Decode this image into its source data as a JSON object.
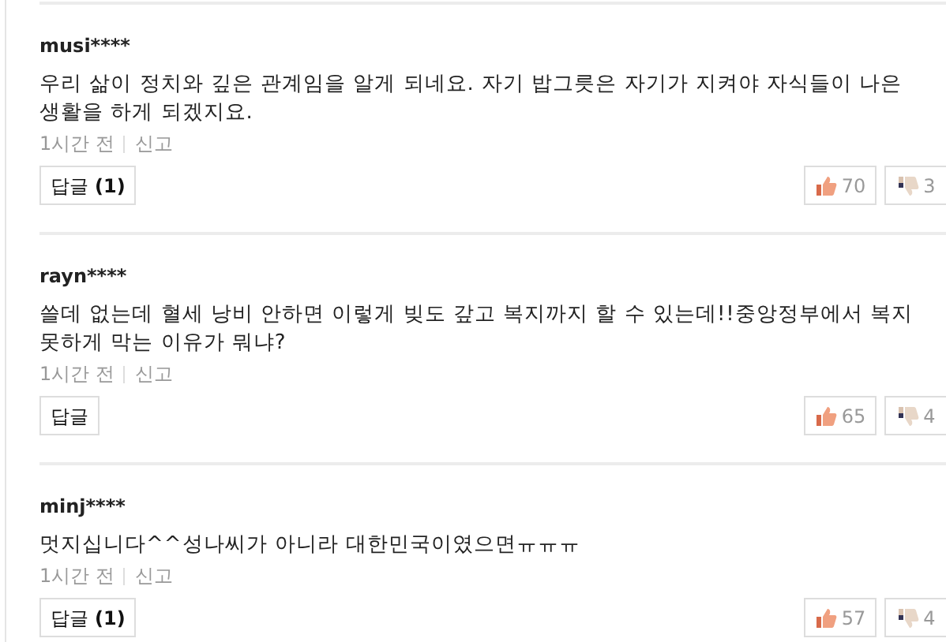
{
  "comments": [
    {
      "user": "musi****",
      "text": "우리 삶이 정치와 깊은 관계임을 알게 되네요. 자기 밥그릇은 자기가 지켜야 자식들이 나은 생활을 하게 되겠지요.",
      "time": "1시간 전",
      "report": "신고",
      "reply": {
        "label": "답글",
        "count": "(1)"
      },
      "likes": "70",
      "dislikes": "3"
    },
    {
      "user": "rayn****",
      "text": "쓸데 없는데 혈세 낭비 안하면 이렇게 빚도 갚고 복지까지 할 수 있는데!!중앙정부에서 복지 못하게 막는 이유가 뭐냐?",
      "time": "1시간 전",
      "report": "신고",
      "reply": {
        "label": "답글"
      },
      "likes": "65",
      "dislikes": "4"
    },
    {
      "user": "minj****",
      "text": "멋지십니다^^성나씨가 아니라 대한민국이였으면ㅠㅠㅠ",
      "time": "1시간 전",
      "report": "신고",
      "reply": {
        "label": "답글",
        "count": "(1)"
      },
      "likes": "57",
      "dislikes": "4"
    }
  ]
}
